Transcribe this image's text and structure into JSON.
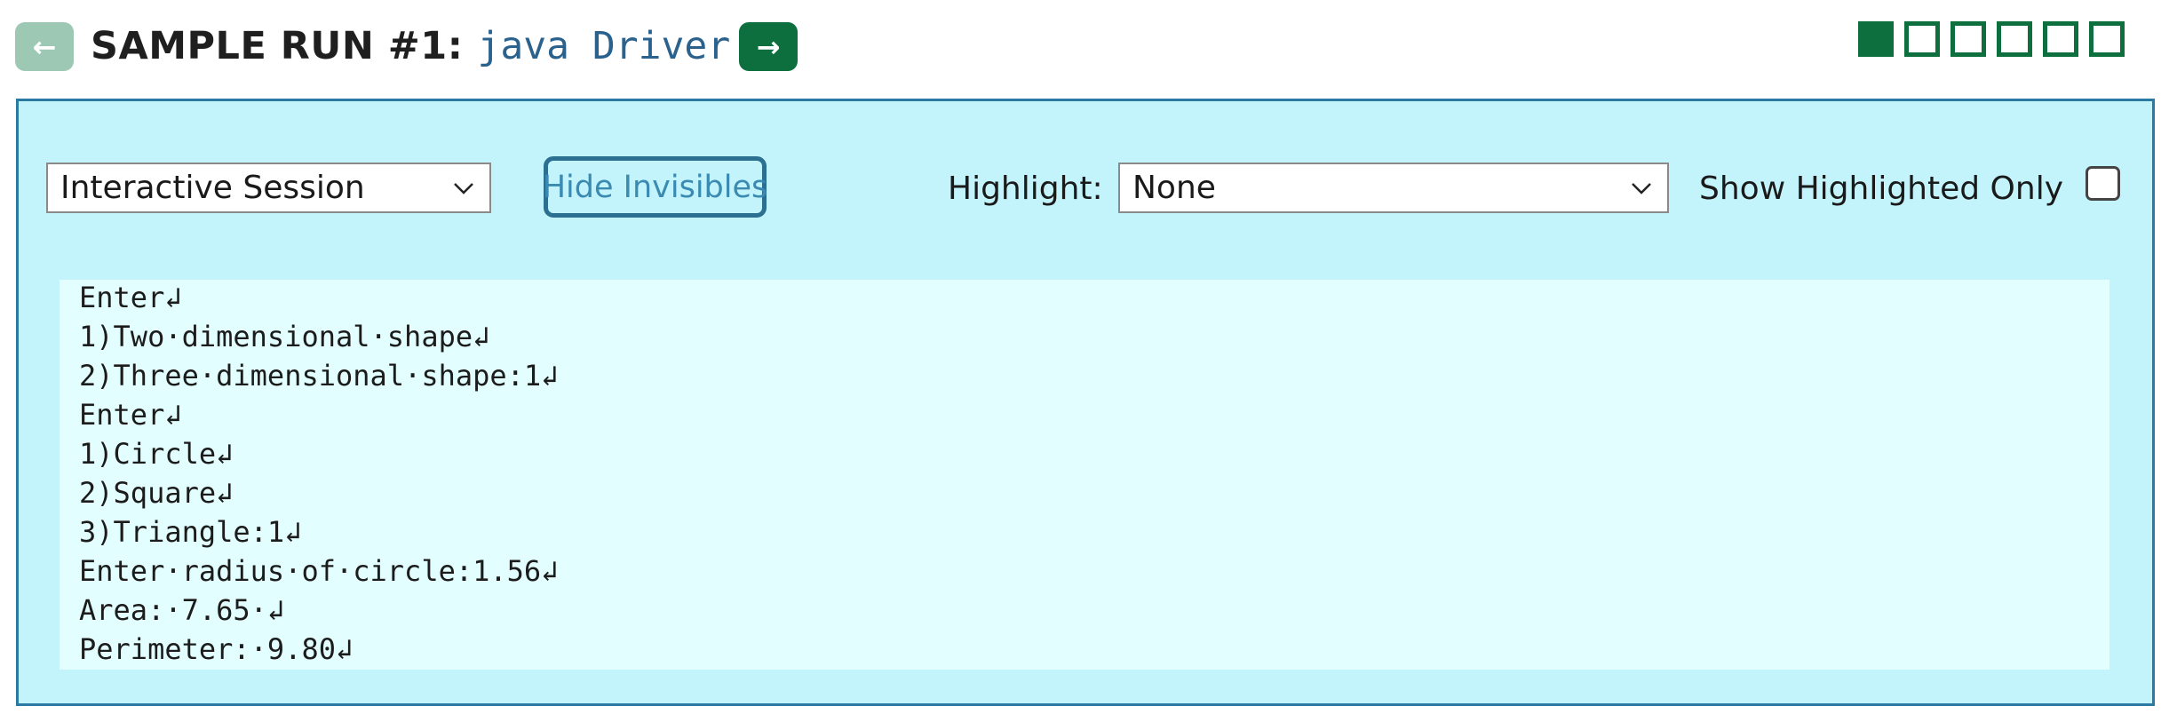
{
  "header": {
    "title": "SAMPLE RUN #1:",
    "command": "java Driver",
    "prev_icon": "←",
    "next_icon": "→",
    "progress": [
      true,
      false,
      false,
      false,
      false,
      false
    ]
  },
  "toolbar": {
    "session_select": "Interactive Session",
    "hide_invisibles_label": "Hide Invisibles",
    "highlight_label": "Highlight:",
    "highlight_select": "None",
    "show_highlighted_label": "Show Highlighted Only",
    "show_highlighted_checked": false
  },
  "console": {
    "lines": [
      "Enter↲",
      "1)Two·dimensional·shape↲",
      "2)Three·dimensional·shape:1↲",
      "Enter↲",
      "1)Circle↲",
      "2)Square↲",
      "3)Triangle:1↲",
      "Enter·radius·of·circle:1.56↲",
      "Area:·7.65·↲",
      "Perimeter:·9.80↲"
    ]
  },
  "colors": {
    "panel_bg": "#c4f4fb",
    "console_bg": "#e2fefe",
    "accent_green": "#0d6e3e",
    "border_blue": "#2b7aa3"
  }
}
